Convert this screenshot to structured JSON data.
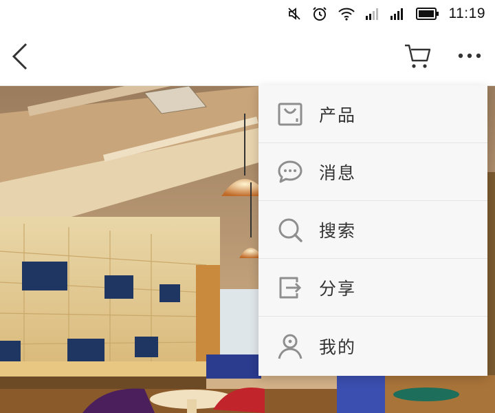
{
  "status_bar": {
    "time": "11:19",
    "icons": [
      "mute-icon",
      "alarm-icon",
      "wifi-icon",
      "signal-icon",
      "signal-icon",
      "battery-icon"
    ]
  },
  "nav": {
    "back_icon": "back-chevron-icon",
    "cart_icon": "cart-icon",
    "more_icon": "more-dots-icon"
  },
  "menu": {
    "items": [
      {
        "label": "产品",
        "icon": "product-bag-icon"
      },
      {
        "label": "消息",
        "icon": "message-bubble-icon"
      },
      {
        "label": "搜索",
        "icon": "search-icon"
      },
      {
        "label": "分享",
        "icon": "share-icon"
      },
      {
        "label": "我的",
        "icon": "user-profile-icon"
      }
    ]
  },
  "colors": {
    "icon_gray": "#8e8e8e",
    "menu_bg": "#f7f7f7",
    "text": "#333333"
  }
}
